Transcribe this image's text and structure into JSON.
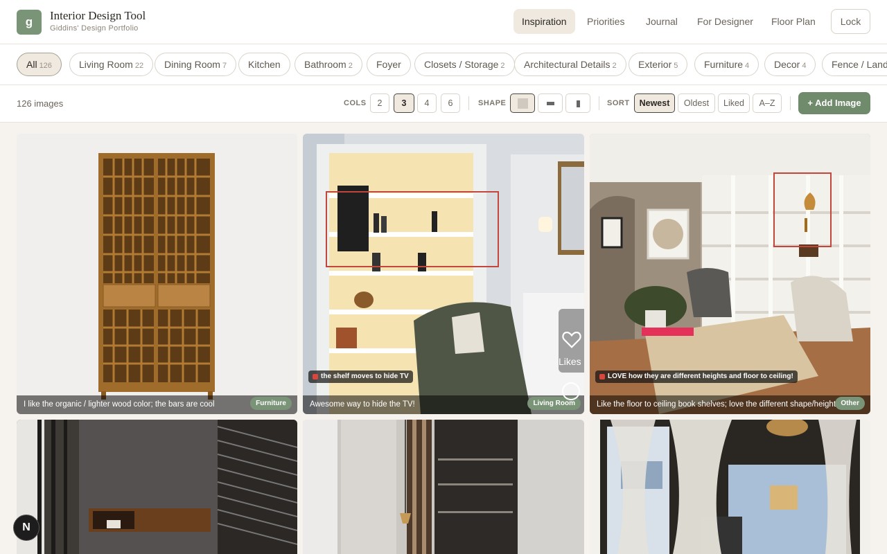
{
  "header": {
    "logo_letter": "g",
    "title": "Interior Design Tool",
    "subtitle": "Giddins' Design Portfolio",
    "nav": [
      "Inspiration",
      "Priorities",
      "Journal",
      "For Designer",
      "Floor Plan"
    ],
    "active_nav": "Inspiration",
    "lock_label": "Lock"
  },
  "categories": [
    {
      "label": "All",
      "count": "126",
      "active": true
    },
    {
      "label": "Living Room",
      "count": "22"
    },
    {
      "label": "Dining Room",
      "count": "7"
    },
    {
      "label": "Kitchen",
      "count": ""
    },
    {
      "label": "Bathroom",
      "count": "2"
    },
    {
      "label": "Foyer",
      "count": ""
    },
    {
      "label": "Closets / Storage",
      "count": "2"
    },
    {
      "label": "Architectural Details",
      "count": "2"
    },
    {
      "label": "Exterior",
      "count": "5"
    },
    {
      "label": "Furniture",
      "count": "4"
    },
    {
      "label": "Decor",
      "count": "4"
    },
    {
      "label": "Fence / Landscape",
      "count": ""
    }
  ],
  "toolbar": {
    "image_count": "126 images",
    "cols_label": "COLS",
    "cols": [
      "2",
      "3",
      "4",
      "6"
    ],
    "active_cols": "3",
    "shape_label": "SHAPE",
    "shapes": [
      "square",
      "landscape",
      "portrait"
    ],
    "active_shape": "square",
    "sort_label": "SORT",
    "sort_options": [
      "Newest",
      "Oldest",
      "Liked",
      "A–Z"
    ],
    "active_sort": "Newest",
    "add_label": "+ Add Image"
  },
  "cards": [
    {
      "caption": "I like the organic / lighter wood color; the bars are cool",
      "tag": "Furniture",
      "note": ""
    },
    {
      "caption": "Awesome way to hide the TV!",
      "tag": "Living Room",
      "note": "the shelf moves to hide TV"
    },
    {
      "caption": "Like the floor to ceiling book shelves; love the different shape/height to sh",
      "tag": "Other",
      "note": "LOVE how they are different heights and floor to ceiling!"
    }
  ],
  "likes_label": "Likes",
  "next_badge": "N",
  "colors": {
    "accent": "#7a9477",
    "annotation": "#c2463b",
    "page_bg": "#f6f3ee"
  }
}
